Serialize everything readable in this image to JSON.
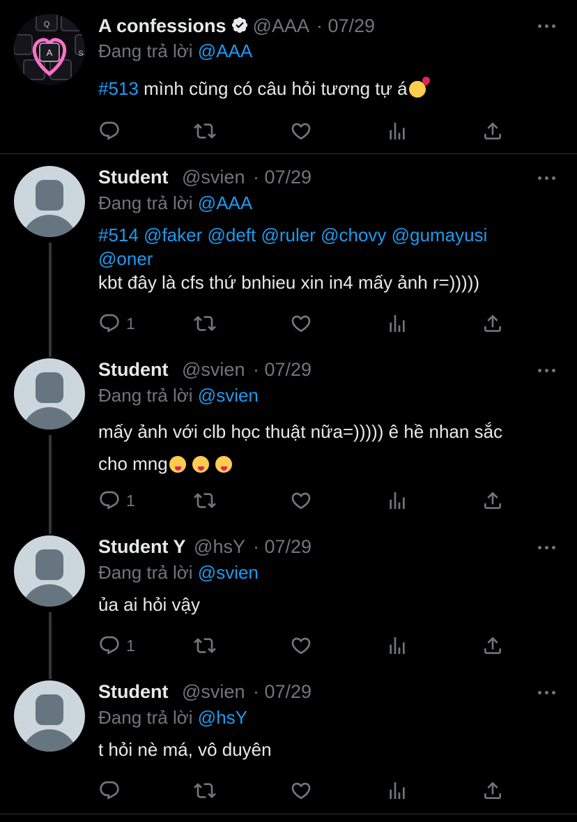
{
  "tweets": [
    {
      "name": "A confessions",
      "handle": "@AAA",
      "date": "· 07/29",
      "verified": true,
      "replying_to_label": "Đang trả lời",
      "replying_to": "@AAA",
      "hashtag": "#513",
      "text": " mình cũng có câu hỏi tương tự á",
      "reply_count": ""
    },
    {
      "name": "Student",
      "handle": "@svien",
      "date": "· 07/29",
      "replying_to_label": "Đang trả lời",
      "replying_to": "@AAA",
      "mentions_line1": "#514 @faker @deft @ruler @chovy @gumayusi",
      "mentions_line2": "@oner",
      "text": "kbt đây là cfs thứ bnhieu xin in4 mấy ảnh r=)))))",
      "reply_count": "1"
    },
    {
      "name": "Student",
      "handle": "@svien",
      "date": "· 07/29",
      "replying_to_label": "Đang trả lời",
      "replying_to": "@svien",
      "text_line1": "mấy ảnh với clb học thuật nữa=))))) ê hề nhan sắc",
      "text_line2": "cho mng",
      "reply_count": "1"
    },
    {
      "name": "Student Y",
      "handle": "@hsY",
      "date": "· 07/29",
      "replying_to_label": "Đang trả lời",
      "replying_to": "@svien",
      "text": "ủa ai hỏi vậy",
      "reply_count": "1"
    },
    {
      "name": "Student",
      "handle": "@svien",
      "date": "· 07/29",
      "replying_to_label": "Đang trả lời",
      "replying_to": "@hsY",
      "text": "t hỏi nè má, vô duyên",
      "reply_count": ""
    }
  ],
  "icons": [
    "reply-icon",
    "retweet-icon",
    "like-icon",
    "analytics-icon",
    "share-icon",
    "more-icon"
  ],
  "colors": {
    "link": "#1d9bf0",
    "muted": "#71767b",
    "text": "#e7e9ea",
    "background": "#000000"
  }
}
